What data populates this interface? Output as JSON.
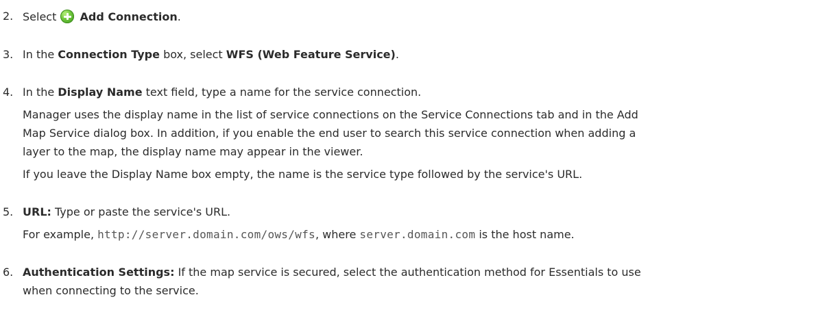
{
  "steps": [
    {
      "number": "2.",
      "prefix": "Select ",
      "icon": "add-icon",
      "bold": "Add Connection",
      "suffix": "."
    },
    {
      "number": "3.",
      "t1": "In the ",
      "b1": "Connection Type",
      "t2": " box, select ",
      "b2": "WFS (Web Feature Service)",
      "t3": "."
    },
    {
      "number": "4.",
      "t1": "In the ",
      "b1": "Display Name",
      "t2": " text field, type a name for the service connection.",
      "p1_l1": "Manager uses the display name in the list of service connections on the Service Connections tab and in the Add",
      "p1_l2": "Map Service dialog box. In addition, if you enable the end user to search this service connection when adding a",
      "p1_l3": "layer to the map, the display name may appear in the viewer.",
      "p2": "If you leave the Display Name box empty, the name is the service type followed by the service's URL."
    },
    {
      "number": "5.",
      "b1": "URL:",
      "t1": " Type or paste the service's URL.",
      "ex_prefix": "For example, ",
      "code1": "http://server.domain.com/ows/wfs",
      "ex_mid": ", where ",
      "code2": "server.domain.com",
      "ex_suffix": " is the host name."
    },
    {
      "number": "6.",
      "b1": "Authentication Settings:",
      "t1": " If the map service is secured, select the authentication method for Essentials to use",
      "l2": "when connecting to the service."
    }
  ]
}
